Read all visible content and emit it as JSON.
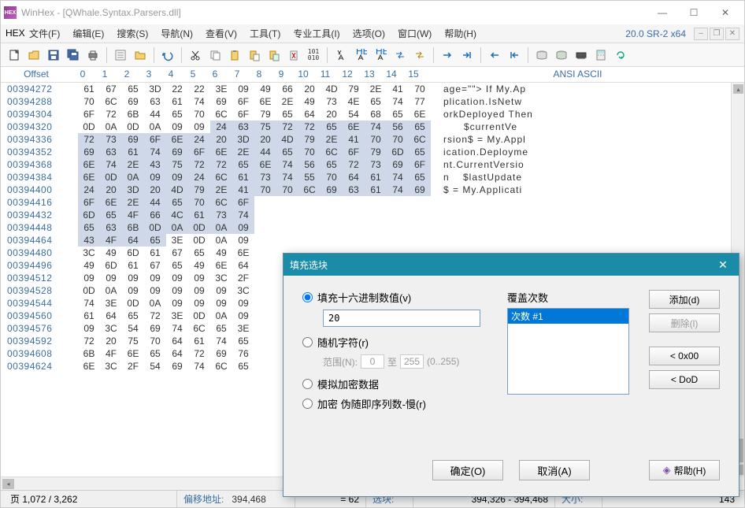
{
  "title": "WinHex - [QWhale.Syntax.Parsers.dll]",
  "app_icon_text": "HEX",
  "version": "20.0 SR-2 x64",
  "menu": [
    "文件(F)",
    "编辑(E)",
    "搜索(S)",
    "导航(N)",
    "查看(V)",
    "工具(T)",
    "专业工具(I)",
    "选项(O)",
    "窗口(W)",
    "帮助(H)"
  ],
  "header": {
    "offset": "Offset",
    "cols": [
      "0",
      "1",
      "2",
      "3",
      "4",
      "5",
      "6",
      "7",
      "8",
      "9",
      "10",
      "11",
      "12",
      "13",
      "14",
      "15"
    ],
    "ascii": "ANSI ASCII"
  },
  "rows": [
    {
      "off": "00394272",
      "b": [
        "61",
        "67",
        "65",
        "3D",
        "22",
        "22",
        "3E",
        "09",
        "49",
        "66",
        "20",
        "4D",
        "79",
        "2E",
        "41",
        "70"
      ],
      "a": "age=\"\"> If My.Ap",
      "sel": []
    },
    {
      "off": "00394288",
      "b": [
        "70",
        "6C",
        "69",
        "63",
        "61",
        "74",
        "69",
        "6F",
        "6E",
        "2E",
        "49",
        "73",
        "4E",
        "65",
        "74",
        "77"
      ],
      "a": "plication.IsNetw",
      "sel": []
    },
    {
      "off": "00394304",
      "b": [
        "6F",
        "72",
        "6B",
        "44",
        "65",
        "70",
        "6C",
        "6F",
        "79",
        "65",
        "64",
        "20",
        "54",
        "68",
        "65",
        "6E"
      ],
      "a": "orkDeployed Then",
      "sel": []
    },
    {
      "off": "00394320",
      "b": [
        "0D",
        "0A",
        "0D",
        "0A",
        "09",
        "09",
        "24",
        "63",
        "75",
        "72",
        "72",
        "65",
        "6E",
        "74",
        "56",
        "65"
      ],
      "a": "      $currentVe",
      "sel": [
        6,
        7,
        8,
        9,
        10,
        11,
        12,
        13,
        14,
        15
      ]
    },
    {
      "off": "00394336",
      "b": [
        "72",
        "73",
        "69",
        "6F",
        "6E",
        "24",
        "20",
        "3D",
        "20",
        "4D",
        "79",
        "2E",
        "41",
        "70",
        "70",
        "6C"
      ],
      "a": "rsion$ = My.Appl",
      "sel": [
        0,
        1,
        2,
        3,
        4,
        5,
        6,
        7,
        8,
        9,
        10,
        11,
        12,
        13,
        14,
        15
      ]
    },
    {
      "off": "00394352",
      "b": [
        "69",
        "63",
        "61",
        "74",
        "69",
        "6F",
        "6E",
        "2E",
        "44",
        "65",
        "70",
        "6C",
        "6F",
        "79",
        "6D",
        "65"
      ],
      "a": "ication.Deployme",
      "sel": [
        0,
        1,
        2,
        3,
        4,
        5,
        6,
        7,
        8,
        9,
        10,
        11,
        12,
        13,
        14,
        15
      ]
    },
    {
      "off": "00394368",
      "b": [
        "6E",
        "74",
        "2E",
        "43",
        "75",
        "72",
        "72",
        "65",
        "6E",
        "74",
        "56",
        "65",
        "72",
        "73",
        "69",
        "6F"
      ],
      "a": "nt.CurrentVersio",
      "sel": [
        0,
        1,
        2,
        3,
        4,
        5,
        6,
        7,
        8,
        9,
        10,
        11,
        12,
        13,
        14,
        15
      ]
    },
    {
      "off": "00394384",
      "b": [
        "6E",
        "0D",
        "0A",
        "09",
        "09",
        "24",
        "6C",
        "61",
        "73",
        "74",
        "55",
        "70",
        "64",
        "61",
        "74",
        "65"
      ],
      "a": "n    $lastUpdate",
      "sel": [
        0,
        1,
        2,
        3,
        4,
        5,
        6,
        7,
        8,
        9,
        10,
        11,
        12,
        13,
        14,
        15
      ]
    },
    {
      "off": "00394400",
      "b": [
        "24",
        "20",
        "3D",
        "20",
        "4D",
        "79",
        "2E",
        "41",
        "70",
        "70",
        "6C",
        "69",
        "63",
        "61",
        "74",
        "69"
      ],
      "a": "$ = My.Applicati",
      "sel": [
        0,
        1,
        2,
        3,
        4,
        5,
        6,
        7,
        8,
        9,
        10,
        11,
        12,
        13,
        14,
        15
      ]
    },
    {
      "off": "00394416",
      "b": [
        "6F",
        "6E",
        "2E",
        "44",
        "65",
        "70",
        "6C",
        "6F"
      ],
      "a": "",
      "sel": [
        0,
        1,
        2,
        3,
        4,
        5,
        6,
        7
      ]
    },
    {
      "off": "00394432",
      "b": [
        "6D",
        "65",
        "4F",
        "66",
        "4C",
        "61",
        "73",
        "74"
      ],
      "a": "",
      "sel": [
        0,
        1,
        2,
        3,
        4,
        5,
        6,
        7
      ]
    },
    {
      "off": "00394448",
      "b": [
        "65",
        "63",
        "6B",
        "0D",
        "0A",
        "0D",
        "0A",
        "09"
      ],
      "a": "",
      "sel": [
        0,
        1,
        2,
        3,
        4,
        5,
        6,
        7
      ]
    },
    {
      "off": "00394464",
      "b": [
        "43",
        "4F",
        "64",
        "65",
        "3E",
        "0D",
        "0A",
        "09"
      ],
      "a": "",
      "sel": [
        0,
        1,
        2,
        3
      ]
    },
    {
      "off": "00394480",
      "b": [
        "3C",
        "49",
        "6D",
        "61",
        "67",
        "65",
        "49",
        "6E"
      ],
      "a": "",
      "sel": []
    },
    {
      "off": "00394496",
      "b": [
        "49",
        "6D",
        "61",
        "67",
        "65",
        "49",
        "6E",
        "64"
      ],
      "a": "",
      "sel": []
    },
    {
      "off": "00394512",
      "b": [
        "09",
        "09",
        "09",
        "09",
        "09",
        "09",
        "3C",
        "2F"
      ],
      "a": "",
      "sel": []
    },
    {
      "off": "00394528",
      "b": [
        "0D",
        "0A",
        "09",
        "09",
        "09",
        "09",
        "09",
        "3C"
      ],
      "a": "",
      "sel": []
    },
    {
      "off": "00394544",
      "b": [
        "74",
        "3E",
        "0D",
        "0A",
        "09",
        "09",
        "09",
        "09"
      ],
      "a": "",
      "sel": []
    },
    {
      "off": "00394560",
      "b": [
        "61",
        "64",
        "65",
        "72",
        "3E",
        "0D",
        "0A",
        "09"
      ],
      "a": "",
      "sel": []
    },
    {
      "off": "00394576",
      "b": [
        "09",
        "3C",
        "54",
        "69",
        "74",
        "6C",
        "65",
        "3E"
      ],
      "a": "",
      "sel": []
    },
    {
      "off": "00394592",
      "b": [
        "72",
        "20",
        "75",
        "70",
        "64",
        "61",
        "74",
        "65"
      ],
      "a": "",
      "sel": []
    },
    {
      "off": "00394608",
      "b": [
        "6B",
        "4F",
        "6E",
        "65",
        "64",
        "72",
        "69",
        "76"
      ],
      "a": "",
      "sel": []
    },
    {
      "off": "00394624",
      "b": [
        "6E",
        "3C",
        "2F",
        "54",
        "69",
        "74",
        "6C",
        "65"
      ],
      "a": "",
      "sel": []
    }
  ],
  "status": {
    "page": "页 1,072 / 3,262",
    "offset_label": "偏移地址:",
    "offset_val": "394,468",
    "eq": "= 62",
    "sel_label": "选块:",
    "sel_val": "394,326 - 394,468",
    "size_label": "大小:",
    "size_val": "143"
  },
  "dialog": {
    "title": "填充选块",
    "radio_hex": "填充十六进制数值(v)",
    "hex_value": "20",
    "radio_random": "随机字符(r)",
    "range_label": "范围(N):",
    "range_from": "0",
    "range_to_label": "至",
    "range_to": "255",
    "range_hint": "(0..255)",
    "radio_sim": "模拟加密数据",
    "radio_enc": "加密 伪随即序列数-慢(r)",
    "passes_label": "覆盖次数",
    "pass_item": "次数 #1",
    "btn_add": "添加(d)",
    "btn_del": "删除(l)",
    "btn_0x00": "< 0x00",
    "btn_dod": "< DoD",
    "btn_ok": "确定(O)",
    "btn_cancel": "取消(A)",
    "btn_help": "帮助(H)"
  }
}
